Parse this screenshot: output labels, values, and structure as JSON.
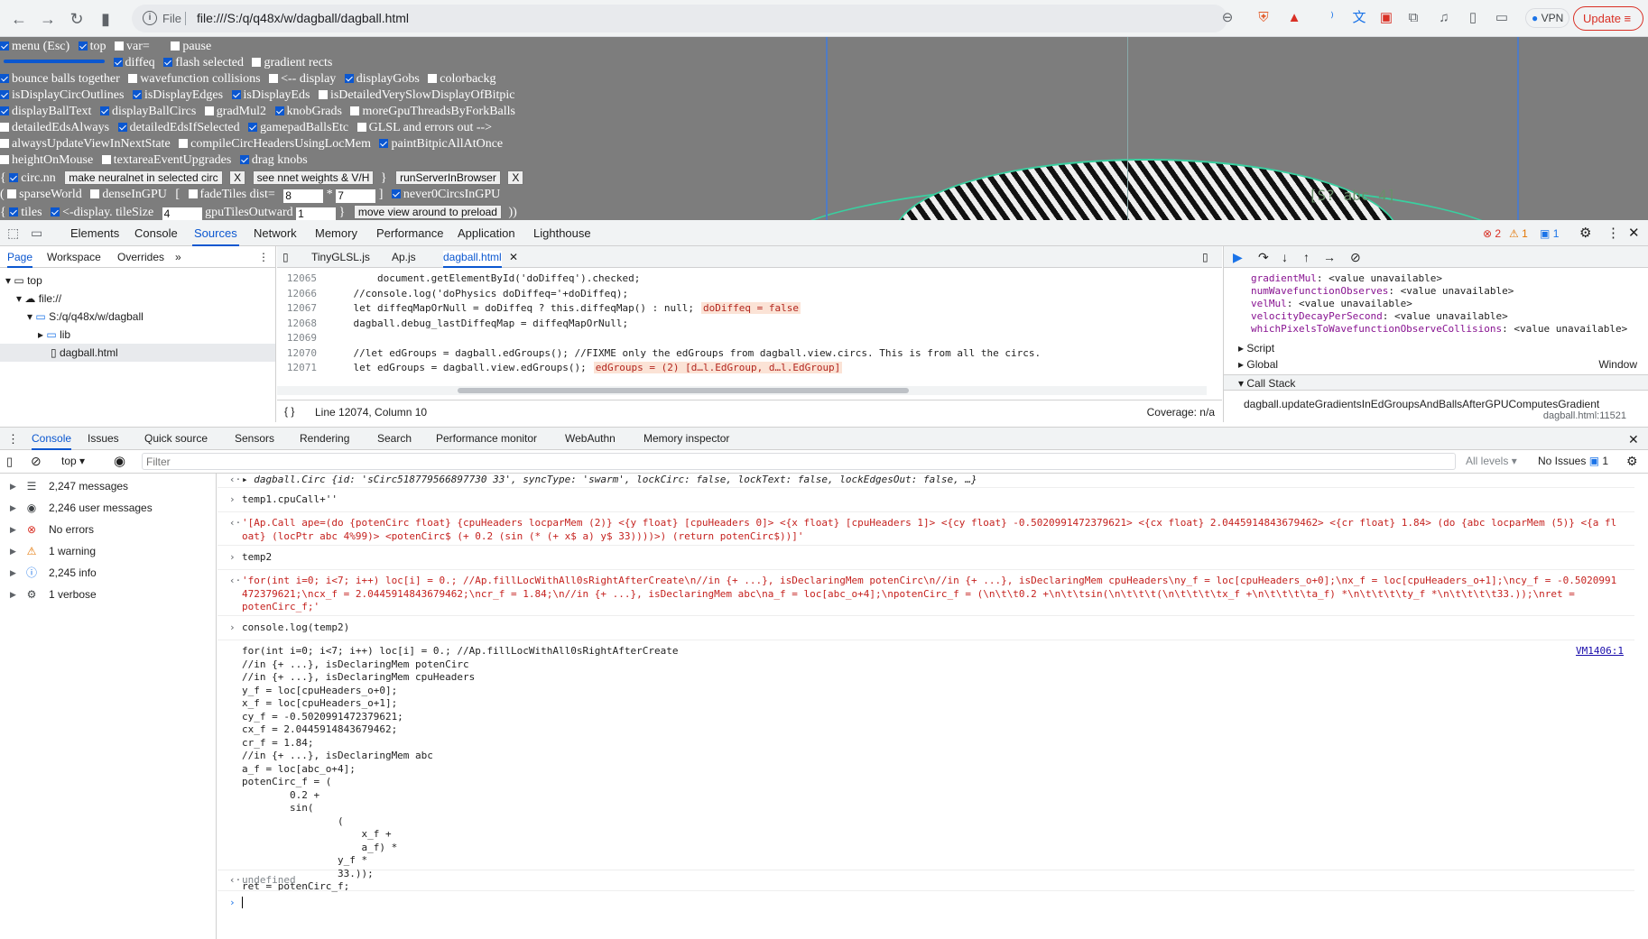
{
  "browser": {
    "file_label": "File",
    "url": "file:///S:/q/q48x/w/dagball/dagball.html",
    "vpn_label": "VPN",
    "update_label": "Update"
  },
  "page": {
    "row1": {
      "menu": "menu (Esc)",
      "top": "top",
      "var": "var=",
      "pause": "pause"
    },
    "row2": {
      "diffeq": "diffeq",
      "flash": "flash selected",
      "gradient": "gradient rects"
    },
    "row3": [
      "bounce balls together",
      "wavefunction collisions",
      "<-- display",
      "displayGobs",
      "colorbackg"
    ],
    "row4": [
      "isDisplayCircOutlines",
      "isDisplayEdges",
      "isDisplayEds",
      "isDetailedVerySlowDisplayOfBitpic"
    ],
    "row5": [
      "displayBallText",
      "displayBallCircs",
      "gradMul2",
      "knobGrads",
      "moreGpuThreadsByForkBalls"
    ],
    "row6": [
      "detailedEdsAlways",
      "detailedEdsIfSelected",
      "gamepadBallsEtc",
      "GLSL and errors out -->"
    ],
    "row7": [
      "alwaysUpdateViewInNextState",
      "compileCircHeadersUsingLocMem",
      "paintBitpicAllAtOnce"
    ],
    "row8": [
      "heightOnMouse",
      "textareaEventUpgrades",
      "drag knobs"
    ],
    "row9": {
      "open": "{",
      "circnn": "circ.nn",
      "btn1": "make neuralnet in selected circ",
      "x1": "X",
      "btn2": "see nnet weights & V/H",
      "close": "}",
      "btn3": "runServerInBrowser",
      "x2": "X"
    },
    "row10": {
      "open": "(",
      "sparse": "sparseWorld",
      "dense": "denseInGPU",
      "bracket": "[",
      "fade": "fadeTiles dist=",
      "dist": "8",
      "star": "*",
      "mult": "7",
      "close": "]",
      "never": "never0CircsInGPU"
    },
    "row11": {
      "open": "{",
      "tiles": "tiles",
      "disp": "<-display. tileSize",
      "tile_size": "4",
      "outward": "gpuTilesOutward",
      "outward_val": "1",
      "close": "}",
      "btn": "move view around to preload",
      "close2": "))"
    },
    "ball_label": "[S? abc 4]"
  },
  "devtools": {
    "tabs": [
      "Elements",
      "Console",
      "Sources",
      "Network",
      "Memory",
      "Performance",
      "Application",
      "Lighthouse"
    ],
    "errors": "2",
    "warnings": "1",
    "messages": "1",
    "nav_tabs": [
      "Page",
      "Workspace",
      "Overrides"
    ],
    "tree": [
      "top",
      "file://",
      "S:/q/q48x/w/dagball",
      "lib",
      "dagball.html"
    ],
    "file_tabs": [
      "TinyGLSL.js",
      "Ap.js",
      "dagball.html"
    ],
    "code": [
      {
        "ln": "12065",
        "code": "        document.getElementById('doDiffeq').checked;",
        "hint": ""
      },
      {
        "ln": "12066",
        "code": "    //console.log('doPhysics doDiffeq='+doDiffeq);",
        "hint": ""
      },
      {
        "ln": "12067",
        "code": "    let diffeqMapOrNull = doDiffeq ? this.diffeqMap() : null;",
        "hint": "doDiffeq = false"
      },
      {
        "ln": "12068",
        "code": "    dagball.debug_lastDiffeqMap = diffeqMapOrNull;",
        "hint": ""
      },
      {
        "ln": "12069",
        "code": "",
        "hint": ""
      },
      {
        "ln": "12070",
        "code": "    //let edGroups = dagball.edGroups(); //FIXME only the edGroups from dagball.view.circs. This is from all the circs.",
        "hint": ""
      },
      {
        "ln": "12071",
        "code": "    let edGroups = dagball.view.edGroups();",
        "hint": "edGroups = (2) [d…l.EdGroup, d…l.EdGroup]"
      }
    ],
    "status": "Line 12074, Column 10",
    "coverage": "Coverage: n/a",
    "scope": [
      {
        "k": "gradientMul",
        "v": "<value unavailable>"
      },
      {
        "k": "numWavefunctionObserves",
        "v": "<value unavailable>"
      },
      {
        "k": "velMul",
        "v": "<value unavailable>"
      },
      {
        "k": "velocityDecayPerSecond",
        "v": "<value unavailable>"
      },
      {
        "k": "whichPixelsToWavefunctionObserveCollisions",
        "v": "<value unavailable>"
      }
    ],
    "script_label": "Script",
    "global_label": "Global",
    "global_val": "Window",
    "callstack_label": "Call Stack",
    "callstack_fn": "dagball.updateGradientsInEdGroupsAndBallsAfterGPUComputesGradient",
    "callstack_loc": "dagball.html:11521"
  },
  "drawer": {
    "tabs": [
      "Console",
      "Issues",
      "Quick source",
      "Sensors",
      "Rendering",
      "Search",
      "Performance monitor",
      "WebAuthn",
      "Memory inspector"
    ],
    "context": "top",
    "filter_placeholder": "Filter",
    "levels": "All levels",
    "issues": "No Issues",
    "issues_count": "1",
    "sidebar": [
      {
        "icon": "list-icon",
        "glyph": "☰",
        "text": "2,247 messages"
      },
      {
        "icon": "user-icon",
        "glyph": "◉",
        "text": "2,246 user messages"
      },
      {
        "icon": "error-icon",
        "glyph": "⊗",
        "text": "No errors"
      },
      {
        "icon": "warning-icon",
        "glyph": "⚠",
        "text": "1 warning"
      },
      {
        "icon": "info-icon",
        "glyph": "ⓘ",
        "text": "2,245 info"
      },
      {
        "icon": "verbose-icon",
        "glyph": "⚙",
        "text": "1 verbose"
      }
    ],
    "console": {
      "l1": "▸ dagball.Circ {id: 'sCirc518779566897730 33', syncType: 'swarm', lockCirc: false, lockText: false, lockEdgesOut: false, …}",
      "l2": "temp1.cpuCall+''",
      "l3a": "'[Ap.Call ape=(do {potenCirc float} {cpuHeaders locparMem (2)} <{y float} [cpuHeaders 0]> <{x float} [cpuHeaders 1]> <{cy float} -0.5020991472379621> <{cx float} 2.0445914843679462> <{cr float} 1.84> (do {abc locparMem (5)} <{a fl",
      "l3b": "oat} (locPtr abc 4%99)> <potenCirc$ (+ 0.2 (sin (* (+ x$ a) y$ 33))))>) (return potenCirc$))]'",
      "l4": "temp2",
      "l5a": "'for(int i=0; i<7; i++) loc[i] = 0.; //Ap.fillLocWithAll0sRightAfterCreate\\n//in {+ ...}, isDeclaringMem potenCirc\\n//in {+ ...}, isDeclaringMem cpuHeaders\\ny_f = loc[cpuHeaders_o+0];\\nx_f = loc[cpuHeaders_o+1];\\ncy_f = -0.5020991",
      "l5b": "472379621;\\ncx_f = 2.0445914843679462;\\ncr_f = 1.84;\\n//in {+ ...}, isDeclaringMem abc\\na_f = loc[abc_o+4];\\npotenCirc_f = (\\n\\t\\t0.2 +\\n\\t\\tsin(\\n\\t\\t\\t(\\n\\t\\t\\t\\tx_f +\\n\\t\\t\\t\\ta_f) *\\n\\t\\t\\t\\ty_f *\\n\\t\\t\\t\\t33.));\\nret =",
      "l5c": "potenCirc_f;'",
      "l6": "console.log(temp2)",
      "log": "for(int i=0; i<7; i++) loc[i] = 0.; //Ap.fillLocWithAll0sRightAfterCreate\n//in {+ ...}, isDeclaringMem potenCirc\n//in {+ ...}, isDeclaringMem cpuHeaders\ny_f = loc[cpuHeaders_o+0];\nx_f = loc[cpuHeaders_o+1];\ncy_f = -0.5020991472379621;\ncx_f = 2.0445914843679462;\ncr_f = 1.84;\n//in {+ ...}, isDeclaringMem abc\na_f = loc[abc_o+4];\npotenCirc_f = (\n        0.2 +\n        sin(\n                (\n                    x_f +\n                    a_f) *\n                y_f *\n                33.));\nret = potenCirc_f;",
      "vm": "VM1406:1",
      "undef": "undefined"
    }
  }
}
